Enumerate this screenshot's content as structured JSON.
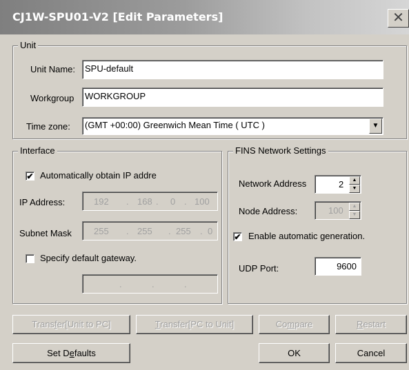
{
  "window": {
    "title": "CJ1W-SPU01-V2 [Edit Parameters]",
    "close_glyph": "✕"
  },
  "unit": {
    "legend": "Unit",
    "name_label": "Unit Name:",
    "name_value": "SPU-default",
    "workgroup_label": "Workgroup",
    "workgroup_value": "WORKGROUP",
    "timezone_label": "Time zone:",
    "timezone_value": "(GMT +00:00)  Greenwich Mean Time ( UTC )"
  },
  "interface": {
    "legend": "Interface",
    "auto_ip_label": "Automatically obtain IP addre",
    "auto_ip_checked": true,
    "ip_label": "IP Address:",
    "ip_octets": [
      "192",
      "168",
      "0",
      "100"
    ],
    "subnet_label": "Subnet Mask",
    "subnet_octets": [
      "255",
      "255",
      "255",
      "0"
    ],
    "gateway_label": "Specify default gateway.",
    "gateway_checked": false,
    "gateway_octets": [
      "",
      "",
      "",
      ""
    ]
  },
  "fins": {
    "legend": "FINS Network Settings",
    "network_label": "Network Address",
    "network_value": "2",
    "node_label": "Node Address:",
    "node_value": "100",
    "auto_gen_label": "Enable automatic generation.",
    "auto_gen_checked": true,
    "udp_label": "UDP Port:",
    "udp_value": "9600"
  },
  "buttons": {
    "transfer_unit_pc": {
      "pre": "Trans",
      "acc": "f",
      "post": "er[Unit to PC]"
    },
    "transfer_pc_unit": {
      "pre": "",
      "acc": "T",
      "post": "ransfer[PC to Unit]"
    },
    "compare": {
      "pre": "Co",
      "acc": "m",
      "post": "pare"
    },
    "restart": {
      "pre": "",
      "acc": "R",
      "post": "estart"
    },
    "set_defaults": {
      "pre": "Set D",
      "acc": "e",
      "post": "faults"
    },
    "ok": "OK",
    "cancel": "Cancel"
  },
  "icons": {
    "check": "✔",
    "combo_arrow": "▼",
    "spin_up": "▲",
    "spin_down": "▼"
  }
}
